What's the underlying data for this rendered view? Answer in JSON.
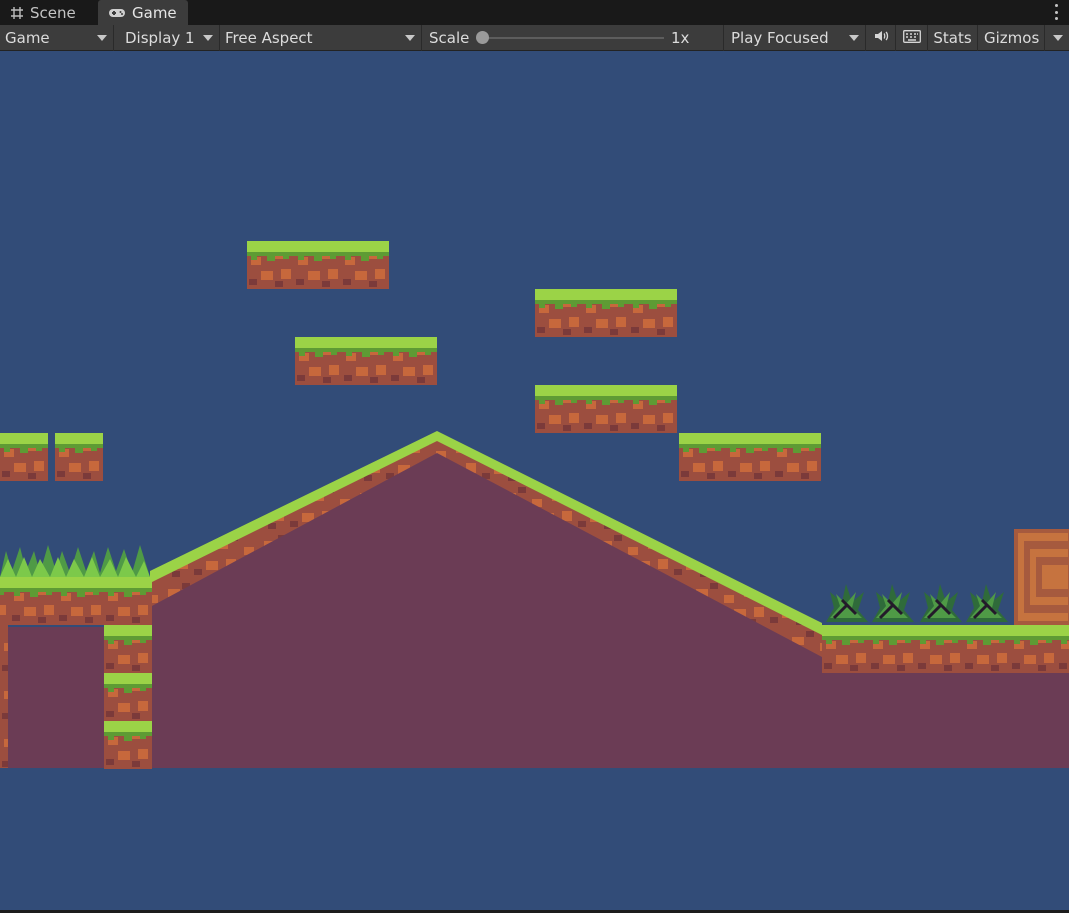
{
  "tabs": [
    {
      "label": "Scene",
      "icon": "grid-icon"
    },
    {
      "label": "Game",
      "icon": "gamepad-icon"
    }
  ],
  "toolbar": {
    "view_mode": "Game",
    "display": "Display 1",
    "aspect": "Free Aspect",
    "scale_label": "Scale",
    "scale_value": "1x",
    "scale_fraction": 0,
    "play_mode": "Play Focused",
    "audio_icon": "speaker-icon",
    "shortcuts_icon": "keyboard-icon",
    "stats_label": "Stats",
    "gizmos_label": "Gizmos"
  },
  "colors": {
    "sky": "#324c78",
    "grass_light": "#9bd347",
    "grass_dark": "#5e9b34",
    "dirt": "#9c4e3f",
    "dirt_light": "#c7683c",
    "fill": "#6b3c55",
    "panel": "#3c3c3c"
  }
}
